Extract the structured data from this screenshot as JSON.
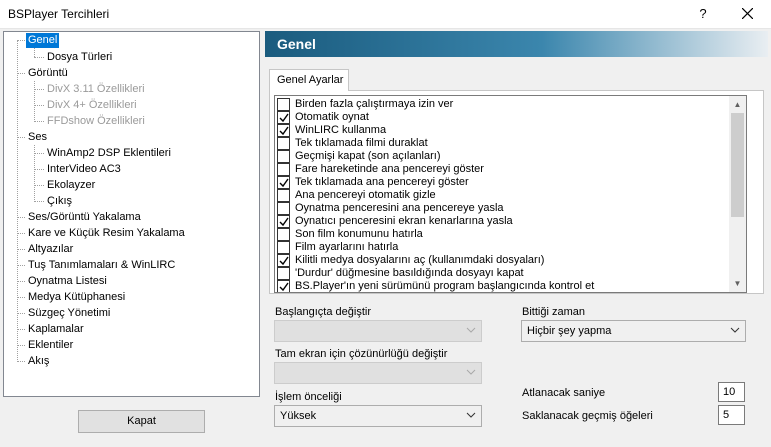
{
  "window": {
    "title": "BSPlayer Tercihleri",
    "help": "?"
  },
  "tree": {
    "items": [
      {
        "label": "Genel"
      },
      {
        "label": "Dosya Türleri"
      },
      {
        "label": "Görüntü"
      },
      {
        "label": "DivX 3.11 Özellikleri"
      },
      {
        "label": "DivX 4+ Özellikleri"
      },
      {
        "label": "FFDshow Özellikleri"
      },
      {
        "label": "Ses"
      },
      {
        "label": "WinAmp2 DSP Eklentileri"
      },
      {
        "label": "InterVideo AC3"
      },
      {
        "label": "Ekolayzer"
      },
      {
        "label": "Çıkış"
      },
      {
        "label": "Ses/Görüntü Yakalama"
      },
      {
        "label": "Kare ve Küçük Resim Yakalama"
      },
      {
        "label": "Altyazılar"
      },
      {
        "label": "Tuş Tanımlamaları & WinLIRC"
      },
      {
        "label": "Oynatma Listesi"
      },
      {
        "label": "Medya Kütüphanesi"
      },
      {
        "label": "Süzgeç Yönetimi"
      },
      {
        "label": "Kaplamalar"
      },
      {
        "label": "Eklentiler"
      },
      {
        "label": "Akış"
      }
    ]
  },
  "close_button": "Kapat",
  "panel": {
    "header": "Genel",
    "tab": "Genel Ayarlar",
    "options": [
      {
        "label": "Birden fazla çalıştırmaya izin ver",
        "checked": false
      },
      {
        "label": "Otomatik oynat",
        "checked": true
      },
      {
        "label": "WinLIRC kullanma",
        "checked": true
      },
      {
        "label": "Tek tıklamada filmi duraklat",
        "checked": false
      },
      {
        "label": "Geçmişi kapat (son açılanları)",
        "checked": false
      },
      {
        "label": "Fare hareketinde ana pencereyi göster",
        "checked": false
      },
      {
        "label": "Tek tıklamada ana pencereyi göster",
        "checked": true
      },
      {
        "label": "Ana pencereyi otomatik gizle",
        "checked": false
      },
      {
        "label": "Oynatma penceresini ana pencereye yasla",
        "checked": false
      },
      {
        "label": "Oynatıcı penceresini ekran kenarlarına yasla",
        "checked": true
      },
      {
        "label": "Son film konumunu hatırla",
        "checked": false
      },
      {
        "label": "Film ayarlarını hatırla",
        "checked": false
      },
      {
        "label": "Kilitli medya dosyalarını aç (kullanımdaki dosyaları)",
        "checked": true
      },
      {
        "label": "'Durdur' düğmesine basıldığında dosyayı kapat",
        "checked": false
      },
      {
        "label": "BS.Player'ın yeni sürümünü program başlangıcında kontrol et",
        "checked": true
      }
    ],
    "startup_change_label": "Başlangıçta değiştir",
    "startup_change_value": "",
    "fullscreen_res_label": "Tam ekran için çözünürlüğü değiştir",
    "fullscreen_res_value": "",
    "priority_label": "İşlem önceliği",
    "priority_value": "Yüksek",
    "on_finish_label": "Bittiği zaman",
    "on_finish_value": "Hiçbir şey yapma",
    "skip_seconds_label": "Atlanacak saniye",
    "skip_seconds_value": "10",
    "history_items_label": "Saklanacak geçmiş öğeleri",
    "history_items_value": "5"
  }
}
